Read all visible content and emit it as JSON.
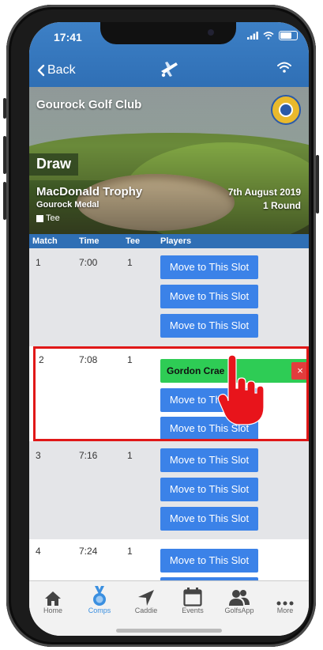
{
  "status": {
    "time": "17:41"
  },
  "nav": {
    "back_label": "Back"
  },
  "club": {
    "name": "Gourock Golf Club"
  },
  "competition": {
    "section_label": "Draw",
    "name": "MacDonald Trophy",
    "sub_name": "Gourock Medal",
    "date": "7th August 2019",
    "rounds": "1 Round",
    "tee_legend": "Tee"
  },
  "table": {
    "headers": {
      "match": "Match",
      "time": "Time",
      "tee": "Tee",
      "players": "Players"
    },
    "slot_label": "Move to This Slot",
    "groups": [
      {
        "match": "1",
        "time": "7:00",
        "tee": "1"
      },
      {
        "match": "2",
        "time": "7:08",
        "tee": "1",
        "player": "Gordon Crae",
        "remove": "×"
      },
      {
        "match": "3",
        "time": "7:16",
        "tee": "1"
      },
      {
        "match": "4",
        "time": "7:24",
        "tee": "1"
      }
    ]
  },
  "tabs": [
    {
      "label": "Home",
      "icon": "home-icon"
    },
    {
      "label": "Comps",
      "icon": "medal-icon",
      "active": true
    },
    {
      "label": "Caddie",
      "icon": "location-arrow-icon"
    },
    {
      "label": "Events",
      "icon": "calendar-icon"
    },
    {
      "label": "GolfsApp",
      "icon": "users-icon"
    },
    {
      "label": "More",
      "icon": "more-icon"
    }
  ],
  "colors": {
    "header_blue": "#2f6fb5",
    "slot_button": "#3b82e8",
    "player_green": "#2ecc55",
    "remove_red": "#e23d3d",
    "highlight_red": "#e01818",
    "active_tab": "#3a8fe0"
  }
}
